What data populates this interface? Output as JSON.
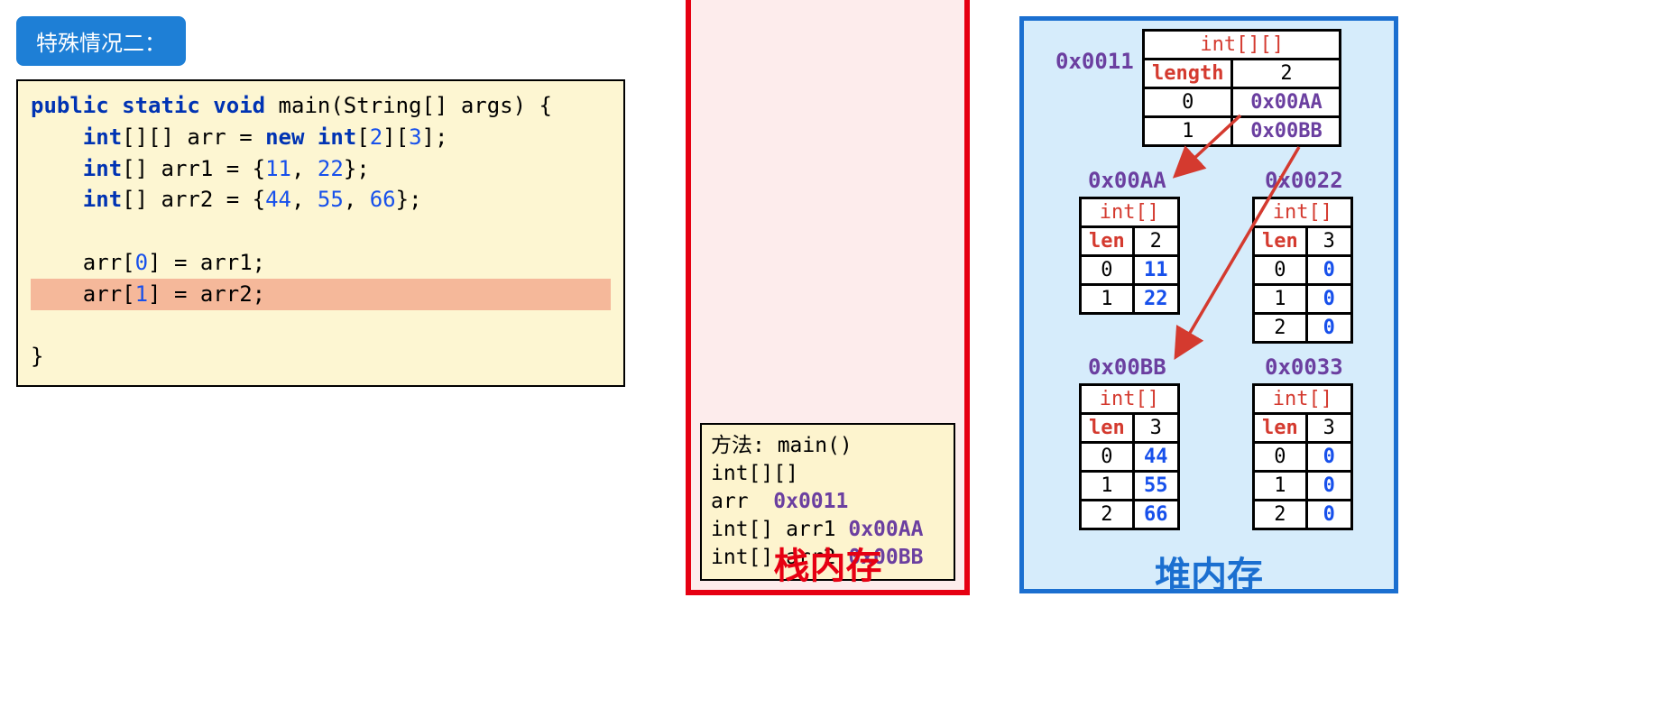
{
  "title": "特殊情况二：",
  "code": {
    "line1_a": "public static void",
    "line1_b": " main(String[] args) {",
    "line2_a": "int",
    "line2_b": "[][] arr = ",
    "line2_c": "new int",
    "line2_d": "[",
    "line2_e": "2",
    "line2_f": "][",
    "line2_g": "3",
    "line2_h": "];",
    "line3_a": "int",
    "line3_b": "[] arr1 = {",
    "line3_c": "11",
    "line3_d": ", ",
    "line3_e": "22",
    "line3_f": "};",
    "line4_a": "int",
    "line4_b": "[] arr2 = {",
    "line4_c": "44",
    "line4_d": ", ",
    "line4_e": "55",
    "line4_f": ", ",
    "line4_g": "66",
    "line4_h": "};",
    "line5_a": "    arr[",
    "line5_b": "0",
    "line5_c": "] = arr1;",
    "line6_a": "    arr[",
    "line6_b": "1",
    "line6_c": "] = arr2;",
    "line7": "}"
  },
  "stack": {
    "label": "栈内存",
    "frame_title": "方法: main()",
    "row1_type": "int[][] arr",
    "row1_addr": "0x0011",
    "row2_type": "int[]   arr1",
    "row2_addr": "0x00AA",
    "row3_type": "int[]   arr2",
    "row3_addr": "0x00BB"
  },
  "heap": {
    "label": "堆内存",
    "t0011": {
      "addr": "0x0011",
      "type": "int[][]",
      "lenlabel": "length",
      "len": "2",
      "i0": "0",
      "v0": "0x00AA",
      "i1": "1",
      "v1": "0x00BB"
    },
    "t00AA": {
      "addr": "0x00AA",
      "type": "int[]",
      "lenlabel": "len",
      "len": "2",
      "i0": "0",
      "v0": "11",
      "i1": "1",
      "v1": "22"
    },
    "t00BB": {
      "addr": "0x00BB",
      "type": "int[]",
      "lenlabel": "len",
      "len": "3",
      "i0": "0",
      "v0": "44",
      "i1": "1",
      "v1": "55",
      "i2": "2",
      "v2": "66"
    },
    "t0022": {
      "addr": "0x0022",
      "type": "int[]",
      "lenlabel": "len",
      "len": "3",
      "i0": "0",
      "v0": "0",
      "i1": "1",
      "v1": "0",
      "i2": "2",
      "v2": "0"
    },
    "t0033": {
      "addr": "0x0033",
      "type": "int[]",
      "lenlabel": "len",
      "len": "3",
      "i0": "0",
      "v0": "0",
      "i1": "1",
      "v1": "0",
      "i2": "2",
      "v2": "0"
    }
  }
}
